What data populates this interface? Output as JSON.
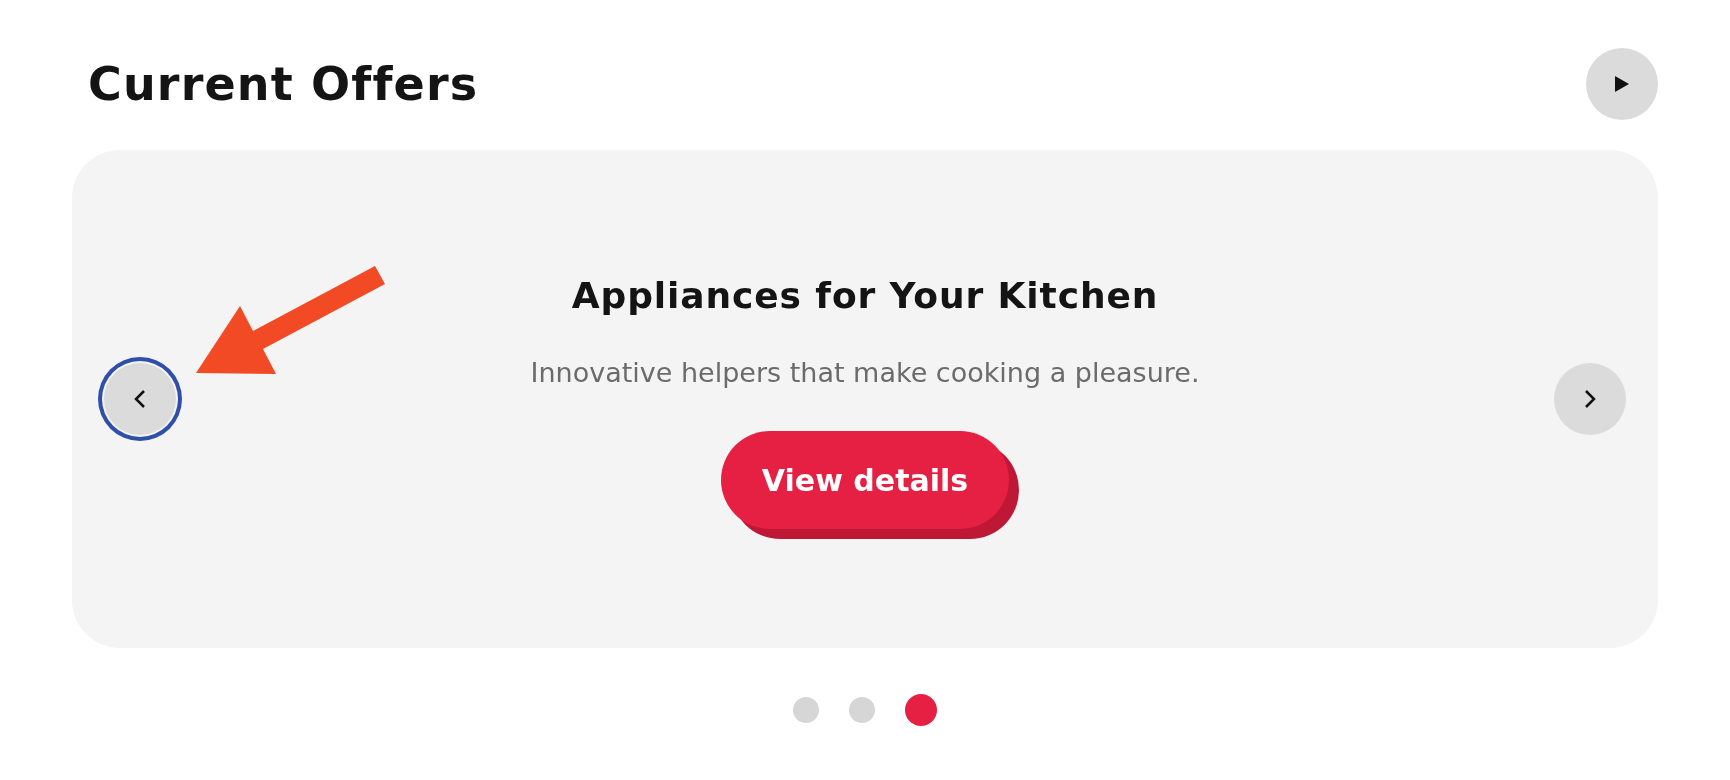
{
  "title": "Current Offers",
  "slide": {
    "heading": "Appliances for Your Kitchen",
    "text": "Innovative helpers that make cooking a pleasure.",
    "button": "View details"
  },
  "prev_button": {
    "focused": true
  },
  "dots": [
    {
      "selected": false
    },
    {
      "selected": false
    },
    {
      "selected": true
    }
  ]
}
